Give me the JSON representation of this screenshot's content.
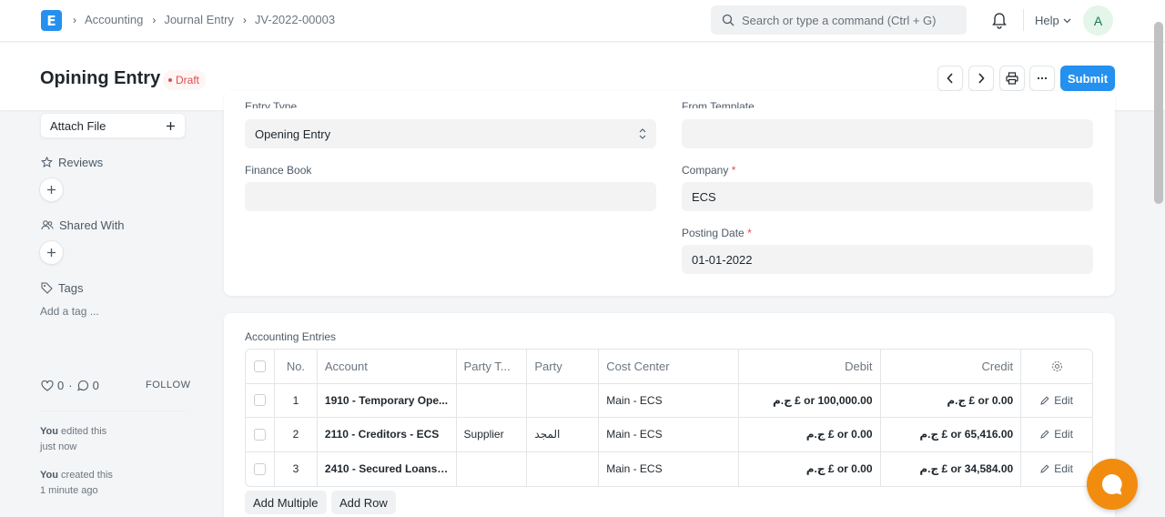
{
  "navbar": {
    "logo_letter": "E",
    "breadcrumbs": [
      "Accounting",
      "Journal Entry",
      "JV-2022-00003"
    ],
    "search_placeholder": "Search or type a command (Ctrl + G)",
    "help_label": "Help",
    "avatar_letter": "A"
  },
  "page": {
    "title": "Opining Entry",
    "status": "Draft",
    "submit_label": "Submit"
  },
  "sidebar": {
    "attach_label": "Attach File",
    "reviews_label": "Reviews",
    "shared_label": "Shared With",
    "tags_label": "Tags",
    "add_tag": "Add a tag ...",
    "likes": "0",
    "comments": "0",
    "follow_label": "FOLLOW",
    "activity": [
      {
        "who": "You",
        "text": "edited this",
        "when": "just now"
      },
      {
        "who": "You",
        "text": "created this",
        "when": "1 minute ago"
      }
    ]
  },
  "form": {
    "entry_type_label": "Entry Type",
    "entry_type_value": "Opening Entry",
    "from_template_label": "From Template",
    "finance_book_label": "Finance Book",
    "company_label": "Company",
    "company_value": "ECS",
    "posting_date_label": "Posting Date",
    "posting_date_value": "01-01-2022",
    "required_mark": "*"
  },
  "entries": {
    "section_label": "Accounting Entries",
    "columns": [
      "No.",
      "Account",
      "Party T...",
      "Party",
      "Cost Center",
      "Debit",
      "Credit"
    ],
    "rows": [
      {
        "no": "1",
        "account": "1910 - Temporary Ope...",
        "party_type": "",
        "party": "",
        "cost_center": "Main - ECS",
        "debit": "ج.م £ or 100,000.00",
        "credit": "ج.م £ or 0.00",
        "edit": "Edit"
      },
      {
        "no": "2",
        "account": "2110 - Creditors - ECS",
        "party_type": "Supplier",
        "party": "المجد",
        "cost_center": "Main - ECS",
        "debit": "ج.م £ or 0.00",
        "credit": "ج.م £ or 65,416.00",
        "edit": "Edit"
      },
      {
        "no": "3",
        "account": "2410 - Secured Loans ...",
        "party_type": "",
        "party": "",
        "cost_center": "Main - ECS",
        "debit": "ج.م £ or 0.00",
        "credit": "ج.م £ or 34,584.00",
        "edit": "Edit"
      }
    ],
    "add_multiple_label": "Add Multiple",
    "add_row_label": "Add Row"
  }
}
